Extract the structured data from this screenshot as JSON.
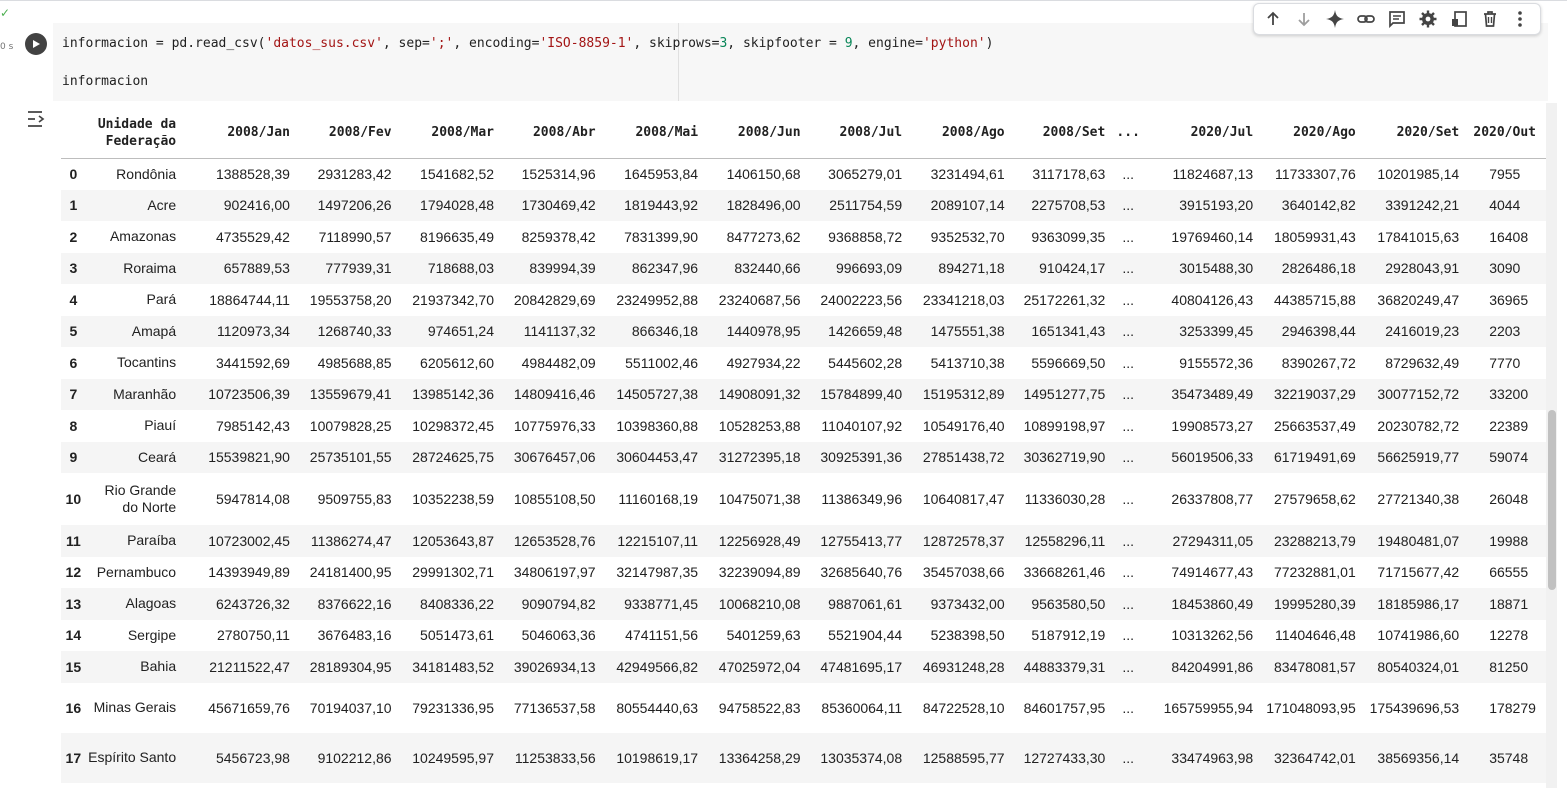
{
  "cell": {
    "exec_time": "0 s",
    "code_line1_parts": [
      {
        "t": "informacion = pd.read_csv(",
        "c": ""
      },
      {
        "t": "'datos_sus.csv'",
        "c": "str"
      },
      {
        "t": ", sep=",
        "c": ""
      },
      {
        "t": "';'",
        "c": "str"
      },
      {
        "t": ", encoding=",
        "c": ""
      },
      {
        "t": "'ISO-8859-1'",
        "c": "str"
      },
      {
        "t": ", skiprows=",
        "c": ""
      },
      {
        "t": "3",
        "c": "num"
      },
      {
        "t": ", skipfooter = ",
        "c": ""
      },
      {
        "t": "9",
        "c": "num"
      },
      {
        "t": ", engine=",
        "c": ""
      },
      {
        "t": "'python'",
        "c": "str"
      },
      {
        "t": ")",
        "c": ""
      }
    ],
    "code_line2": "informacion"
  },
  "toolbar": {
    "icons": [
      "arrow-up-icon",
      "arrow-down-icon",
      "gemini-sparkle-icon",
      "link-icon",
      "comment-icon",
      "gear-icon",
      "mirror-cell-icon",
      "trash-icon",
      "more-vert-icon"
    ]
  },
  "table": {
    "corner_header": "Unidade da Federação",
    "columns": [
      "2008/Jan",
      "2008/Fev",
      "2008/Mar",
      "2008/Abr",
      "2008/Mai",
      "2008/Jun",
      "2008/Jul",
      "2008/Ago",
      "2008/Set",
      "...",
      "2020/Jul",
      "2020/Ago",
      "2020/Set",
      "2020/Out"
    ],
    "rows": [
      {
        "idx": "0",
        "state": "Rondônia",
        "values": [
          "1388528,39",
          "2931283,42",
          "1541682,52",
          "1525314,96",
          "1645953,84",
          "1406150,68",
          "3065279,01",
          "3231494,61",
          "3117178,63",
          "...",
          "11824687,13",
          "11733307,76",
          "10201985,14",
          "7955"
        ]
      },
      {
        "idx": "1",
        "state": "Acre",
        "values": [
          "902416,00",
          "1497206,26",
          "1794028,48",
          "1730469,42",
          "1819443,92",
          "1828496,00",
          "2511754,59",
          "2089107,14",
          "2275708,53",
          "...",
          "3915193,20",
          "3640142,82",
          "3391242,21",
          "4044"
        ]
      },
      {
        "idx": "2",
        "state": "Amazonas",
        "values": [
          "4735529,42",
          "7118990,57",
          "8196635,49",
          "8259378,42",
          "7831399,90",
          "8477273,62",
          "9368858,72",
          "9352532,70",
          "9363099,35",
          "...",
          "19769460,14",
          "18059931,43",
          "17841015,63",
          "16408"
        ]
      },
      {
        "idx": "3",
        "state": "Roraima",
        "values": [
          "657889,53",
          "777939,31",
          "718688,03",
          "839994,39",
          "862347,96",
          "832440,66",
          "996693,09",
          "894271,18",
          "910424,17",
          "...",
          "3015488,30",
          "2826486,18",
          "2928043,91",
          "3090"
        ]
      },
      {
        "idx": "4",
        "state": "Pará",
        "values": [
          "18864744,11",
          "19553758,20",
          "21937342,70",
          "20842829,69",
          "23249952,88",
          "23240687,56",
          "24002223,56",
          "23341218,03",
          "25172261,32",
          "...",
          "40804126,43",
          "44385715,88",
          "36820249,47",
          "36965"
        ]
      },
      {
        "idx": "5",
        "state": "Amapá",
        "values": [
          "1120973,34",
          "1268740,33",
          "974651,24",
          "1141137,32",
          "866346,18",
          "1440978,95",
          "1426659,48",
          "1475551,38",
          "1651341,43",
          "...",
          "3253399,45",
          "2946398,44",
          "2416019,23",
          "2203"
        ]
      },
      {
        "idx": "6",
        "state": "Tocantins",
        "values": [
          "3441592,69",
          "4985688,85",
          "6205612,60",
          "4984482,09",
          "5511002,46",
          "4927934,22",
          "5445602,28",
          "5413710,38",
          "5596669,50",
          "...",
          "9155572,36",
          "8390267,72",
          "8729632,49",
          "7770"
        ]
      },
      {
        "idx": "7",
        "state": "Maranhão",
        "values": [
          "10723506,39",
          "13559679,41",
          "13985142,36",
          "14809416,46",
          "14505727,38",
          "14908091,32",
          "15784899,40",
          "15195312,89",
          "14951277,75",
          "...",
          "35473489,49",
          "32219037,29",
          "30077152,72",
          "33200"
        ]
      },
      {
        "idx": "8",
        "state": "Piauí",
        "values": [
          "7985142,43",
          "10079828,25",
          "10298372,45",
          "10775976,33",
          "10398360,88",
          "10528253,88",
          "11040107,92",
          "10549176,40",
          "10899198,97",
          "...",
          "19908573,27",
          "25663537,49",
          "20230782,72",
          "22389"
        ]
      },
      {
        "idx": "9",
        "state": "Ceará",
        "values": [
          "15539821,90",
          "25735101,55",
          "28724625,75",
          "30676457,06",
          "30604453,47",
          "31272395,18",
          "30925391,36",
          "27851438,72",
          "30362719,90",
          "...",
          "56019506,33",
          "61719491,69",
          "56625919,77",
          "59074"
        ]
      },
      {
        "idx": "10",
        "state": "Rio Grande do Norte",
        "values": [
          "5947814,08",
          "9509755,83",
          "10352238,59",
          "10855108,50",
          "11160168,19",
          "10475071,38",
          "11386349,96",
          "10640817,47",
          "11336030,28",
          "...",
          "26337808,77",
          "27579658,62",
          "27721340,38",
          "26048"
        ]
      },
      {
        "idx": "11",
        "state": "Paraíba",
        "values": [
          "10723002,45",
          "11386274,47",
          "12053643,87",
          "12653528,76",
          "12215107,11",
          "12256928,49",
          "12755413,77",
          "12872578,37",
          "12558296,11",
          "...",
          "27294311,05",
          "23288213,79",
          "19480481,07",
          "19988"
        ]
      },
      {
        "idx": "12",
        "state": "Pernambuco",
        "values": [
          "14393949,89",
          "24181400,95",
          "29991302,71",
          "34806197,97",
          "32147987,35",
          "32239094,89",
          "32685640,76",
          "35457038,66",
          "33668261,46",
          "...",
          "74914677,43",
          "77232881,01",
          "71715677,42",
          "66555"
        ]
      },
      {
        "idx": "13",
        "state": "Alagoas",
        "values": [
          "6243726,32",
          "8376622,16",
          "8408336,22",
          "9090794,82",
          "9338771,45",
          "10068210,08",
          "9887061,61",
          "9373432,00",
          "9563580,50",
          "...",
          "18453860,49",
          "19995280,39",
          "18185986,17",
          "18871"
        ]
      },
      {
        "idx": "14",
        "state": "Sergipe",
        "values": [
          "2780750,11",
          "3676483,16",
          "5051473,61",
          "5046063,36",
          "4741151,56",
          "5401259,63",
          "5521904,44",
          "5238398,50",
          "5187912,19",
          "...",
          "10313262,56",
          "11404646,48",
          "10741986,60",
          "12278"
        ]
      },
      {
        "idx": "15",
        "state": "Bahia",
        "values": [
          "21211522,47",
          "28189304,95",
          "34181483,52",
          "39026934,13",
          "42949566,82",
          "47025972,04",
          "47481695,17",
          "46931248,28",
          "44883379,31",
          "...",
          "84204991,86",
          "83478081,57",
          "80540324,01",
          "81250"
        ]
      },
      {
        "idx": "16",
        "state": "Minas Gerais",
        "values": [
          "45671659,76",
          "70194037,10",
          "79231336,95",
          "77136537,58",
          "80554440,63",
          "94758522,83",
          "85360064,11",
          "84722528,10",
          "84601757,95",
          "...",
          "165759955,94",
          "171048093,95",
          "175439696,53",
          "178279"
        ]
      },
      {
        "idx": "17",
        "state": "Espírito Santo",
        "values": [
          "5456723,98",
          "9102212,86",
          "10249595,97",
          "11253833,56",
          "10198619,17",
          "13364258,29",
          "13035374,08",
          "12588595,77",
          "12727433,30",
          "...",
          "33474963,98",
          "32364742,01",
          "38569356,14",
          "35748"
        ]
      }
    ]
  }
}
